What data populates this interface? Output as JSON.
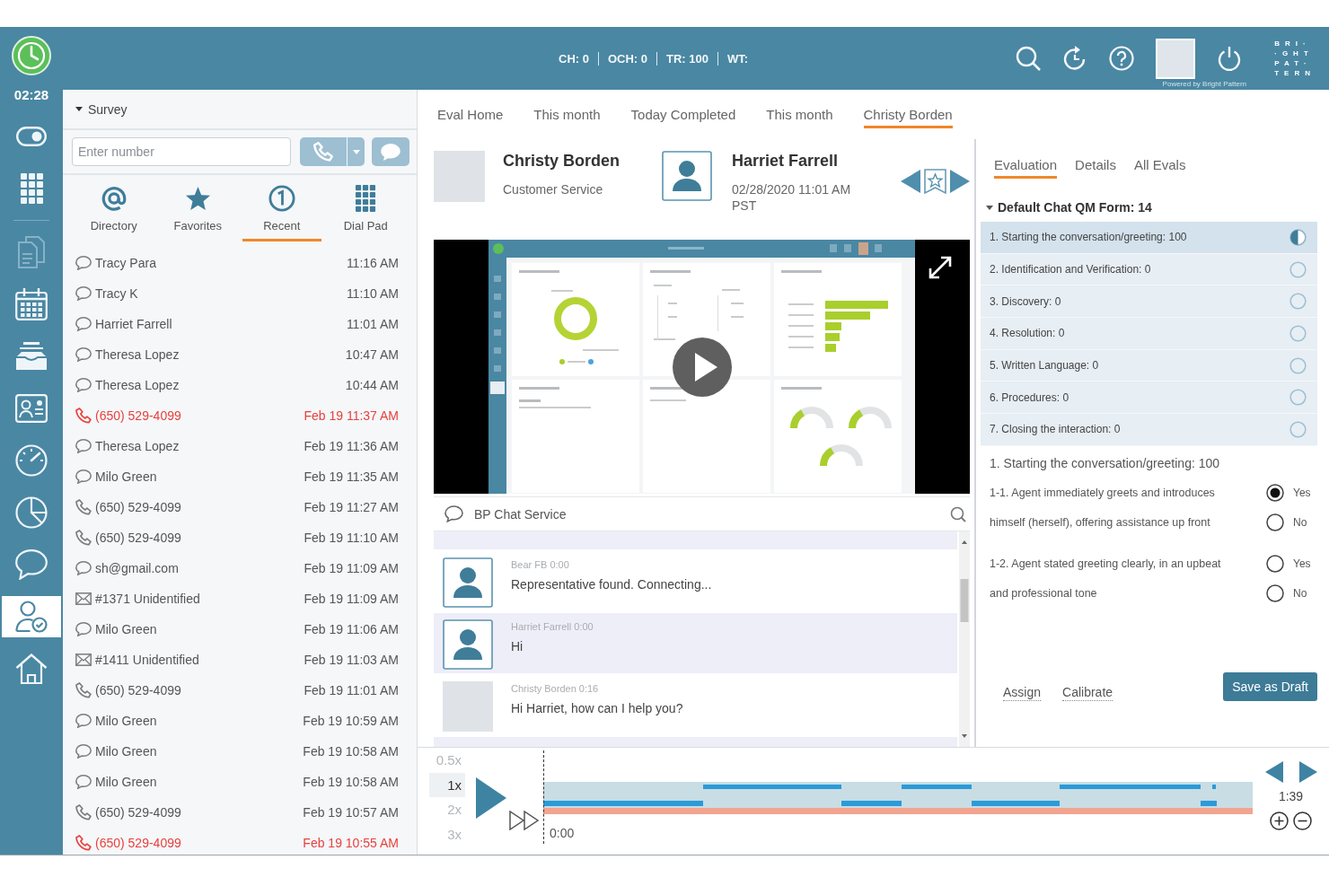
{
  "rail": {
    "timer": "02:28",
    "groups": [
      [
        {
          "kind": "toggle",
          "selected": false,
          "disabled": false
        },
        {
          "kind": "dialpad",
          "selected": false,
          "disabled": false
        }
      ],
      [
        {
          "kind": "documents",
          "selected": false,
          "disabled": true
        },
        {
          "kind": "calendar",
          "selected": false,
          "disabled": false
        },
        {
          "kind": "tray",
          "selected": false,
          "disabled": false
        },
        {
          "kind": "contact-card",
          "selected": false,
          "disabled": false
        },
        {
          "kind": "gauge",
          "selected": false,
          "disabled": false
        },
        {
          "kind": "pie",
          "selected": false,
          "disabled": false
        },
        {
          "kind": "chat",
          "selected": false,
          "disabled": false
        },
        {
          "kind": "agent",
          "selected": true,
          "disabled": false
        },
        {
          "kind": "home",
          "selected": false,
          "disabled": false
        }
      ]
    ]
  },
  "top_bar": {
    "stats": [
      "CH: 0",
      "OCH: 0",
      "TR: 100",
      "WT:"
    ],
    "powered_by": "Powered by Bright Pattern",
    "logo": [
      "BRI·",
      "·GHT",
      "PAT·",
      "TERN"
    ]
  },
  "contacts_panel": {
    "section": {
      "label": "Survey",
      "expanded": true
    },
    "number_field": {
      "placeholder": "Enter number"
    },
    "tabs": [
      {
        "kind": "directory",
        "label": "Directory",
        "selected": false
      },
      {
        "kind": "favorites",
        "label": "Favorites",
        "selected": false
      },
      {
        "kind": "recent",
        "label": "Recent",
        "selected": true
      },
      {
        "kind": "dialpad",
        "label": "Dial Pad",
        "selected": false
      }
    ],
    "recent": [
      {
        "kind": "chat",
        "name": "Tracy Para",
        "time": "11:16 AM",
        "missed": false
      },
      {
        "kind": "chat",
        "name": "Tracy K",
        "time": "11:10 AM",
        "missed": false
      },
      {
        "kind": "chat",
        "name": "Harriet Farrell",
        "time": "11:01 AM",
        "missed": false
      },
      {
        "kind": "chat",
        "name": "Theresa Lopez",
        "time": "10:47 AM",
        "missed": false
      },
      {
        "kind": "chat",
        "name": "Theresa Lopez",
        "time": "10:44 AM",
        "missed": false
      },
      {
        "kind": "call",
        "name": "(650) 529-4099",
        "time": "Feb 19 11:37 AM",
        "missed": true
      },
      {
        "kind": "chat",
        "name": "Theresa Lopez",
        "time": "Feb 19 11:36 AM",
        "missed": false
      },
      {
        "kind": "chat",
        "name": "Milo Green",
        "time": "Feb 19 11:35 AM",
        "missed": false
      },
      {
        "kind": "call",
        "name": "(650) 529-4099",
        "time": "Feb 19 11:27 AM",
        "missed": false
      },
      {
        "kind": "call",
        "name": "(650) 529-4099",
        "time": "Feb 19 11:10 AM",
        "missed": false
      },
      {
        "kind": "chat",
        "name": "sh@gmail.com",
        "time": "Feb 19 11:09 AM",
        "missed": false
      },
      {
        "kind": "email",
        "name": "#1371 Unidentified",
        "time": "Feb 19 11:09 AM",
        "missed": false
      },
      {
        "kind": "chat",
        "name": "Milo Green",
        "time": "Feb 19 11:06 AM",
        "missed": false
      },
      {
        "kind": "email",
        "name": "#1411 Unidentified",
        "time": "Feb 19 11:03 AM",
        "missed": false
      },
      {
        "kind": "call",
        "name": "(650) 529-4099",
        "time": "Feb 19 11:01 AM",
        "missed": false
      },
      {
        "kind": "chat",
        "name": "Milo Green",
        "time": "Feb 19 10:59 AM",
        "missed": false
      },
      {
        "kind": "chat",
        "name": "Milo Green",
        "time": "Feb 19 10:58 AM",
        "missed": false
      },
      {
        "kind": "chat",
        "name": "Milo Green",
        "time": "Feb 19 10:58 AM",
        "missed": false
      },
      {
        "kind": "call",
        "name": "(650) 529-4099",
        "time": "Feb 19 10:57 AM",
        "missed": false
      },
      {
        "kind": "call",
        "name": "(650) 529-4099",
        "time": "Feb 19 10:55 AM",
        "missed": true
      }
    ]
  },
  "eval_tabs": [
    {
      "label": "Eval Home",
      "selected": false
    },
    {
      "label": "This month",
      "selected": false
    },
    {
      "label": "Today Completed",
      "selected": false
    },
    {
      "label": "This month",
      "selected": false
    },
    {
      "label": "Christy Borden",
      "selected": true
    }
  ],
  "interaction": {
    "agent": {
      "name": "Christy Borden",
      "role": "Customer Service"
    },
    "contact": {
      "name": "Harriet Farrell",
      "datetime": "02/28/2020 11:01 AM PST"
    }
  },
  "chat": {
    "title": "BP Chat Service",
    "messages": [
      {
        "kind": "silhouette",
        "author": "Bear FB 0:00",
        "text": "Representative found. Connecting...",
        "highlighted": false
      },
      {
        "kind": "silhouette",
        "author": "Harriet Farrell 0:00",
        "text": "Hi",
        "highlighted": true
      },
      {
        "kind": "photo",
        "author": "Christy Borden 0:16",
        "text": "Hi Harriet, how can I help you?",
        "highlighted": false
      }
    ]
  },
  "evaluation": {
    "tabs": [
      {
        "label": "Evaluation",
        "selected": true
      },
      {
        "label": "Details",
        "selected": false
      },
      {
        "label": "All Evals",
        "selected": false
      }
    ],
    "form": {
      "title": "Default Chat QM Form: 14",
      "expanded": true
    },
    "sections": [
      {
        "label": "1. Starting the conversation/greeting: 100",
        "selected": true,
        "in_progress": true
      },
      {
        "label": "2. Identification and Verification: 0",
        "selected": false,
        "in_progress": false
      },
      {
        "label": "3. Discovery: 0",
        "selected": false,
        "in_progress": false
      },
      {
        "label": "4. Resolution: 0",
        "selected": false,
        "in_progress": false
      },
      {
        "label": "5. Written Language: 0",
        "selected": false,
        "in_progress": false
      },
      {
        "label": "6. Procedures: 0",
        "selected": false,
        "in_progress": false
      },
      {
        "label": "7. Closing the interaction: 0",
        "selected": false,
        "in_progress": false
      }
    ],
    "detail_title": "1. Starting the conversation/greeting: 100",
    "questions": [
      {
        "text": "1-1. Agent immediately greets and introduces himself (herself), offering assistance up front",
        "options": [
          {
            "label": "Yes",
            "selected": true
          },
          {
            "label": "No",
            "selected": false
          }
        ]
      },
      {
        "text": "1-2. Agent stated greeting clearly, in an upbeat and professional tone",
        "options": [
          {
            "label": "Yes",
            "selected": false
          },
          {
            "label": "No",
            "selected": false
          }
        ]
      }
    ],
    "links": [
      "Assign",
      "Calibrate"
    ],
    "save_button": "Save as Draft"
  },
  "player": {
    "speeds": [
      {
        "label": "0.5x",
        "selected": false
      },
      {
        "label": "1x",
        "selected": true
      },
      {
        "label": "2x",
        "selected": false
      },
      {
        "label": "3x",
        "selected": false
      }
    ],
    "position": "0:00",
    "duration": "1:39"
  }
}
